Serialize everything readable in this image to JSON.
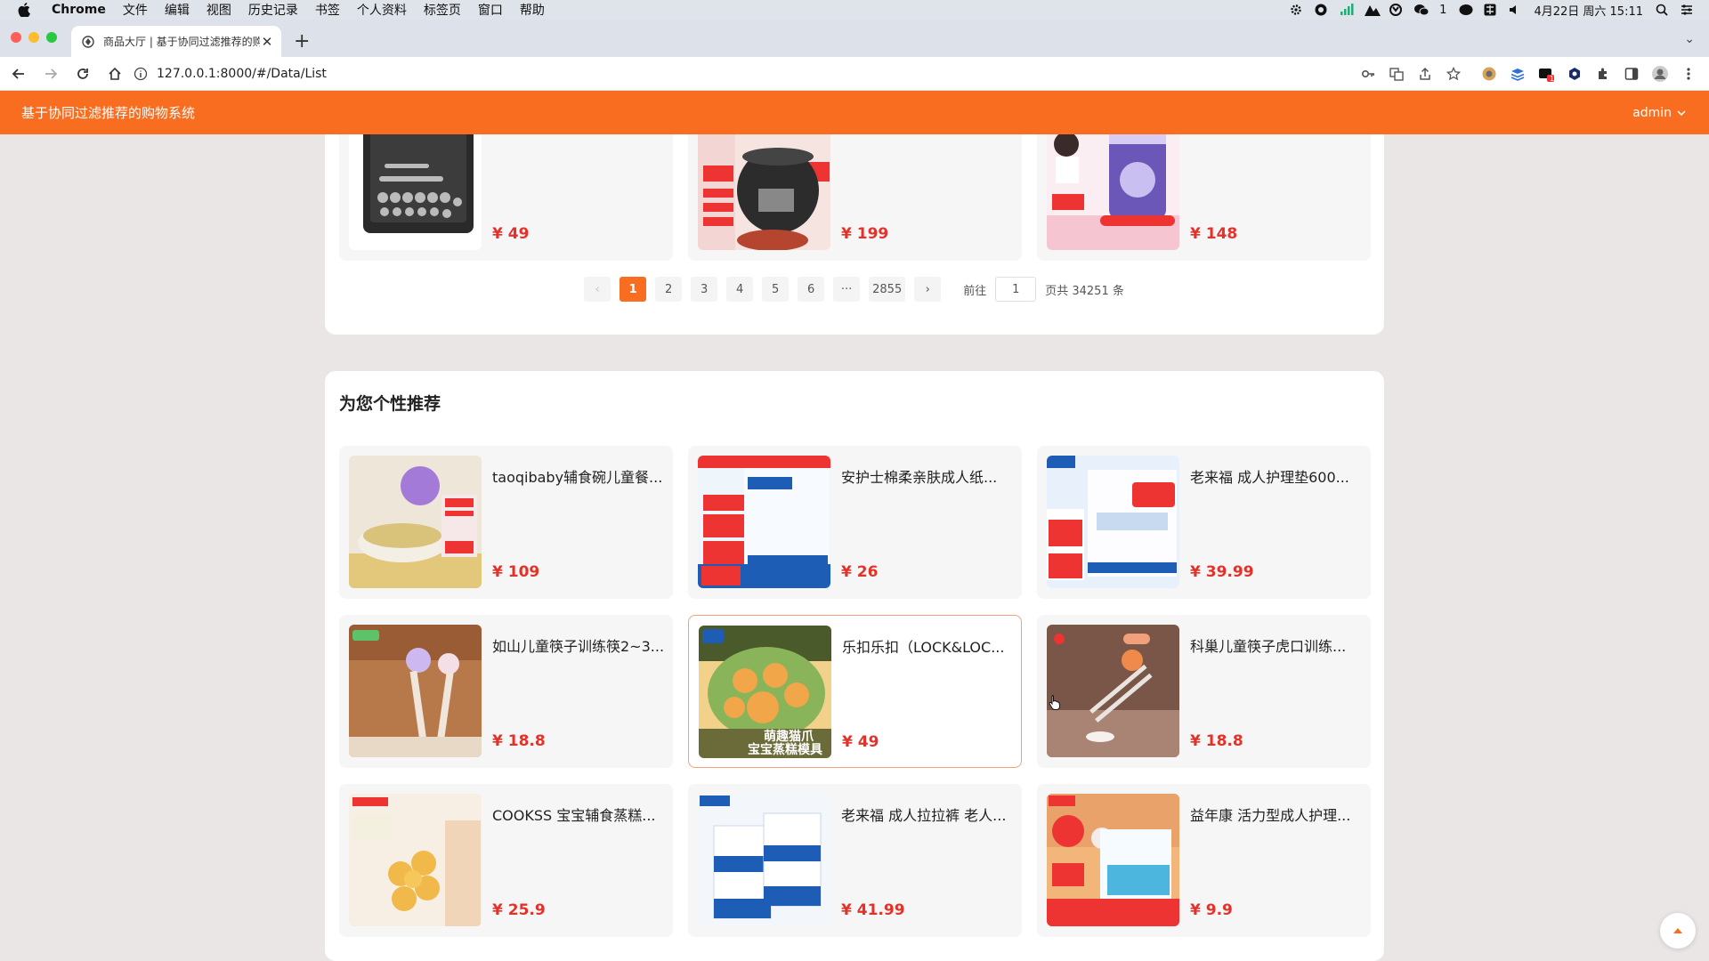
{
  "menubar": {
    "app": "Chrome",
    "items": [
      "文件",
      "编辑",
      "视图",
      "历史记录",
      "书签",
      "个人资料",
      "标签页",
      "窗口",
      "帮助"
    ],
    "wechat_count": "1",
    "datetime": "4月22日 周六 15:11"
  },
  "browser": {
    "tab_title": "商品大厅 | 基于协同过滤推荐的购物系统",
    "url": "127.0.0.1:8000/#/Data/List",
    "ext_badge": "1"
  },
  "app": {
    "title": "基于协同过滤推荐的购物系统",
    "user": "admin"
  },
  "top_products": [
    {
      "price": "¥ 49",
      "thumb": "tool-set"
    },
    {
      "price": "¥ 199",
      "thumb": "pressure-cooker"
    },
    {
      "price": "¥ 148",
      "thumb": "milk-powder"
    }
  ],
  "pagination": {
    "prev": "‹",
    "pages": [
      "1",
      "2",
      "3",
      "4",
      "5",
      "6"
    ],
    "ellipsis": "···",
    "last": "2855",
    "next": "›",
    "goto_label": "前往",
    "goto_value": "1",
    "total_label": "页共 34251 条",
    "active": "1"
  },
  "recommend": {
    "title": "为您个性推荐",
    "items": [
      {
        "name": "taoqibaby辅食碗儿童餐...",
        "price": "¥ 109",
        "thumb": "baby-bowl"
      },
      {
        "name": "安护士棉柔亲肤成人纸...",
        "price": "¥ 26",
        "thumb": "adult-diaper"
      },
      {
        "name": "老来福 成人护理垫600...",
        "price": "¥ 39.99",
        "thumb": "care-pad"
      },
      {
        "name": "如山儿童筷子训练筷2~3...",
        "price": "¥ 18.8",
        "thumb": "training-chopsticks"
      },
      {
        "name": "乐扣乐扣（LOCK&LOC...",
        "price": "¥ 49",
        "thumb": "steam-mold",
        "thumb_text": [
          "萌趣猫爪",
          "宝宝蒸糕模具"
        ]
      },
      {
        "name": "科巢儿童筷子虎口训练...",
        "price": "¥ 18.8",
        "thumb": "tiger-chopsticks"
      },
      {
        "name": "COOKSS 宝宝辅食蒸糕...",
        "price": "¥ 25.9",
        "thumb": "silicone-mold"
      },
      {
        "name": "老来福 成人拉拉裤 老人...",
        "price": "¥ 41.99",
        "thumb": "pull-up-pants"
      },
      {
        "name": "益年康 活力型成人护理...",
        "price": "¥ 9.9",
        "thumb": "nursing-pad"
      }
    ]
  },
  "colors": {
    "accent": "#f86d1f",
    "price": "#e2332b",
    "page_bg": "#ebe6e6"
  }
}
